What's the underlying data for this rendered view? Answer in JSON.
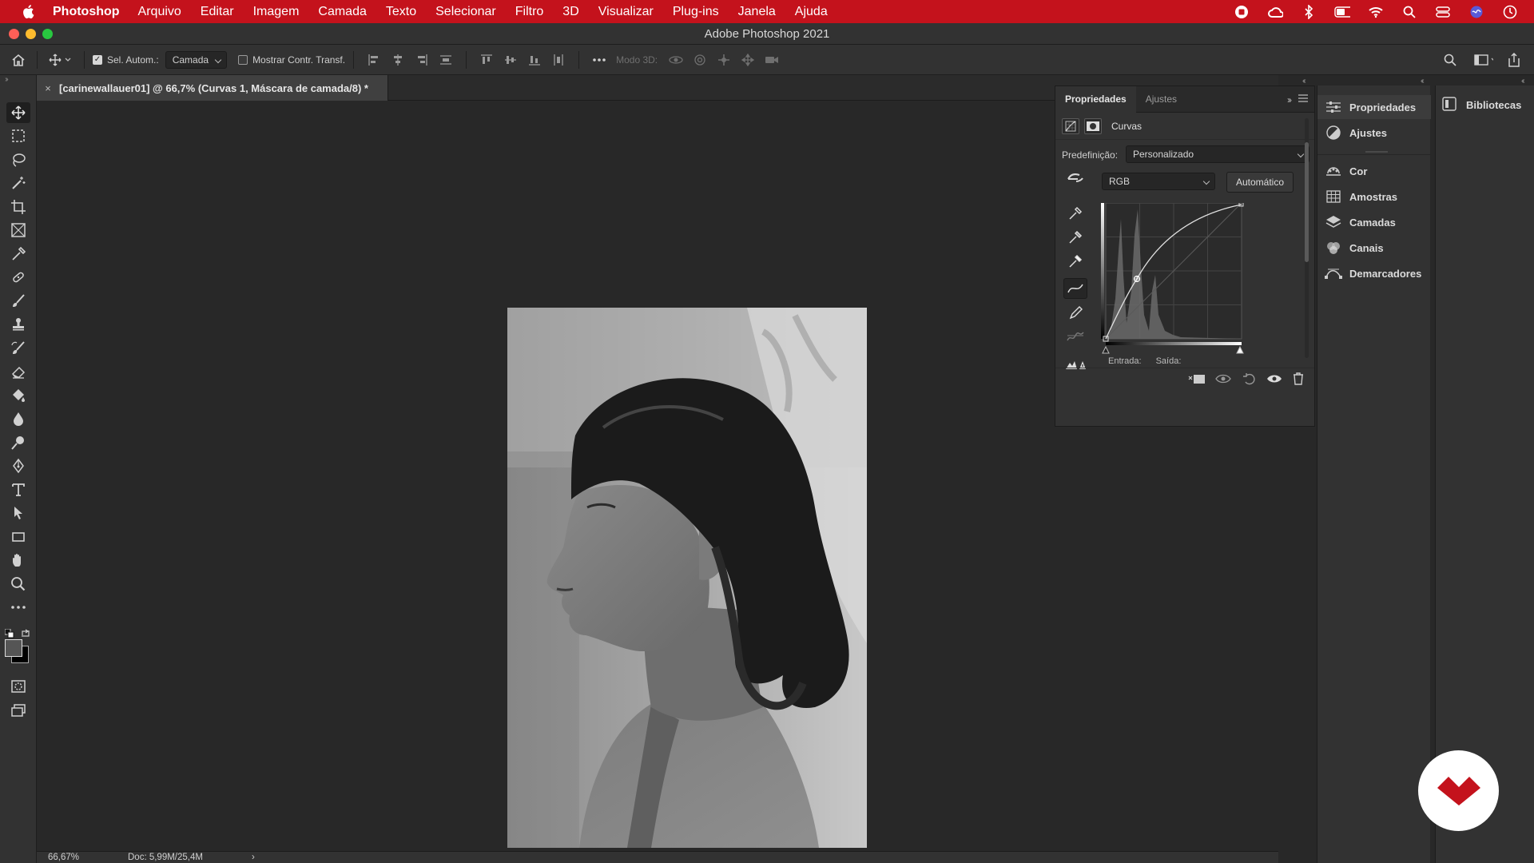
{
  "menubar": {
    "app_name": "Photoshop",
    "items": [
      "Arquivo",
      "Editar",
      "Imagem",
      "Camada",
      "Texto",
      "Selecionar",
      "Filtro",
      "3D",
      "Visualizar",
      "Plug-ins",
      "Janela",
      "Ajuda"
    ]
  },
  "window": {
    "title": "Adobe Photoshop 2021"
  },
  "options": {
    "auto_select_label": "Sel. Autom.:",
    "auto_select_target": "Camada",
    "show_transform_label": "Mostrar Contr. Transf.",
    "mode_3d_label": "Modo 3D:"
  },
  "document": {
    "tab_title": "[carinewallauer01] @ 66,7% (Curvas 1, Máscara de camada/8) *"
  },
  "status": {
    "zoom": "66,67%",
    "doc_size": "Doc: 5,99M/25,4M",
    "arrow": "›"
  },
  "properties": {
    "tab_active": "Propriedades",
    "tab_other": "Ajustes",
    "adjustment_name": "Curvas",
    "preset_label": "Predefinição:",
    "preset_value": "Personalizado",
    "channel_value": "RGB",
    "auto_button": "Automático",
    "input_label": "Entrada:",
    "output_label": "Saída:"
  },
  "dock": {
    "items": [
      "Propriedades",
      "Ajustes",
      "Cor",
      "Amostras",
      "Camadas",
      "Canais",
      "Demarcadores"
    ],
    "libraries": "Bibliotecas"
  },
  "colors": {
    "menubar_bg": "#c4121c",
    "panel_bg": "#323232",
    "canvas_bg": "#282828",
    "brand_red": "#c4121c"
  }
}
